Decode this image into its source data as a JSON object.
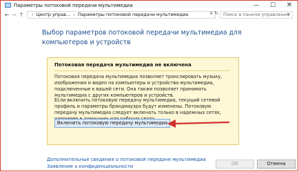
{
  "window": {
    "title": "Параметры потоковой передачи мультимедиа",
    "minimize_glyph": "—",
    "maximize_glyph": "☐",
    "close_glyph": "✕"
  },
  "address": {
    "back_glyph": "←",
    "forward_glyph": "→",
    "up_glyph": "↑",
    "crumbs": [
      "Центр управ...",
      "Параметры потоковой передачи мультимедиа"
    ],
    "separator": "›",
    "dropdown_glyph": "∨",
    "refresh_glyph": "↻",
    "search_placeholder": "Поиск в панели управления",
    "search_icon_glyph": "⚲"
  },
  "main": {
    "heading": "Выбор параметров потоковой передачи мультимедиа для компьютеров и устройств",
    "warning": {
      "title": "Потоковая передача мультимедиа не включена",
      "p1": "Потоковая передача мультимедиа позволяет транслировать музыку, изображения и видео на компьютеры и устройства мультимедиа, подключенные к вашей сети. Она также позволяет принимать мультимедиа с других компьютеров и устройств.",
      "p2": "Если включить потоковую передачу мультимедиа, текущий сетевой профиль и параметры брандмауэра будут изменены. Потоковую передачу мультимедиа следует включать только в надежных сетях, например в домашних или рабочих сетях.",
      "enable_button": "Включить потоковую передачу мультимедиа"
    },
    "links": [
      "Дополнительные сведения о потоковой передаче мультимедиа",
      "Заявление о конфиденциальности"
    ]
  },
  "footer": {
    "ok_label": "ОК",
    "cancel_label": "Отмена"
  },
  "colors": {
    "accent": "#1e4e8c",
    "warning_bg": "#fff8d6",
    "arrow": "#d32f2f"
  }
}
